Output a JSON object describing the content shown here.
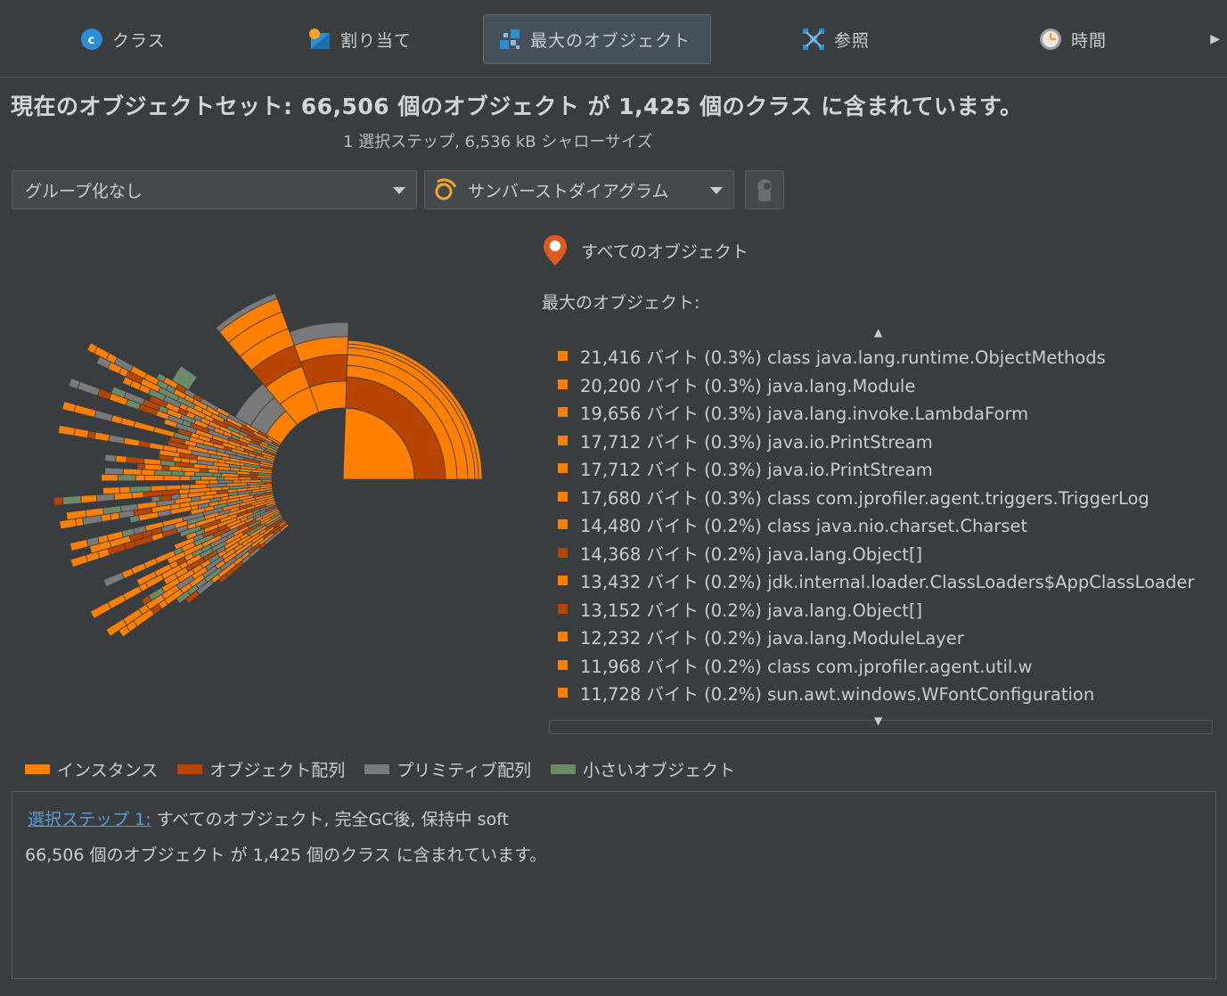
{
  "tabs": [
    {
      "label": "クラス",
      "icon": "class-icon"
    },
    {
      "label": "割り当て",
      "icon": "allocations-icon"
    },
    {
      "label": "最大のオブジェクト",
      "icon": "biggest-objects-icon",
      "active": true
    },
    {
      "label": "参照",
      "icon": "references-icon"
    },
    {
      "label": "時間",
      "icon": "time-clock-icon"
    }
  ],
  "header": {
    "title": "現在のオブジェクトセット:  66,506 個のオブジェクト が 1,425 個のクラス に含まれています。",
    "subtitle": "1 選択ステップ, 6,536 kB シャローサイズ"
  },
  "toolbar": {
    "grouping": "グループ化なし",
    "view": "サンバーストダイアグラム"
  },
  "filter": {
    "label": "すべてのオブジェクト"
  },
  "biggest": {
    "label": "最大のオブジェクト:",
    "items": [
      {
        "text": "21,416 バイト (0.3%) class java.lang.runtime.ObjectMethods",
        "kind": "instance"
      },
      {
        "text": "20,200 バイト (0.3%) java.lang.Module",
        "kind": "instance"
      },
      {
        "text": "19,656 バイト (0.3%) java.lang.invoke.LambdaForm",
        "kind": "instance"
      },
      {
        "text": "17,712 バイト (0.3%) java.io.PrintStream",
        "kind": "instance"
      },
      {
        "text": "17,712 バイト (0.3%) java.io.PrintStream",
        "kind": "instance"
      },
      {
        "text": "17,680 バイト (0.3%) class com.jprofiler.agent.triggers.TriggerLog",
        "kind": "instance"
      },
      {
        "text": "14,480 バイト (0.2%) class java.nio.charset.Charset",
        "kind": "instance"
      },
      {
        "text": "14,368 バイト (0.2%) java.lang.Object[]",
        "kind": "array"
      },
      {
        "text": "13,432 バイト (0.2%) jdk.internal.loader.ClassLoaders$AppClassLoader",
        "kind": "instance"
      },
      {
        "text": "13,152 バイト (0.2%) java.lang.Object[]",
        "kind": "array"
      },
      {
        "text": "12,232 バイト (0.2%) java.lang.ModuleLayer",
        "kind": "instance"
      },
      {
        "text": "11,968 バイト (0.2%) class com.jprofiler.agent.util.w",
        "kind": "instance"
      },
      {
        "text": "11,728 バイト (0.2%) sun.awt.windows.WFontConfiguration",
        "kind": "instance"
      }
    ]
  },
  "legend": [
    {
      "label": "インスタンス",
      "color": "#ff8000"
    },
    {
      "label": "オブジェクト配列",
      "color": "#b84400"
    },
    {
      "label": "プリミティブ配列",
      "color": "#7a7a7a"
    },
    {
      "label": "小さいオブジェクト",
      "color": "#6a8a68"
    }
  ],
  "detail": {
    "link": "選択ステップ 1:",
    "step": " すべてのオブジェクト, 完全GC後, 保持中 soft",
    "summary": "66,506 個のオブジェクト が 1,425 個のクラス に含まれています。"
  },
  "colors": {
    "instance": "#ff8000",
    "array": "#b84400",
    "primitive": "#7a7a7a",
    "small": "#6a8a68"
  }
}
